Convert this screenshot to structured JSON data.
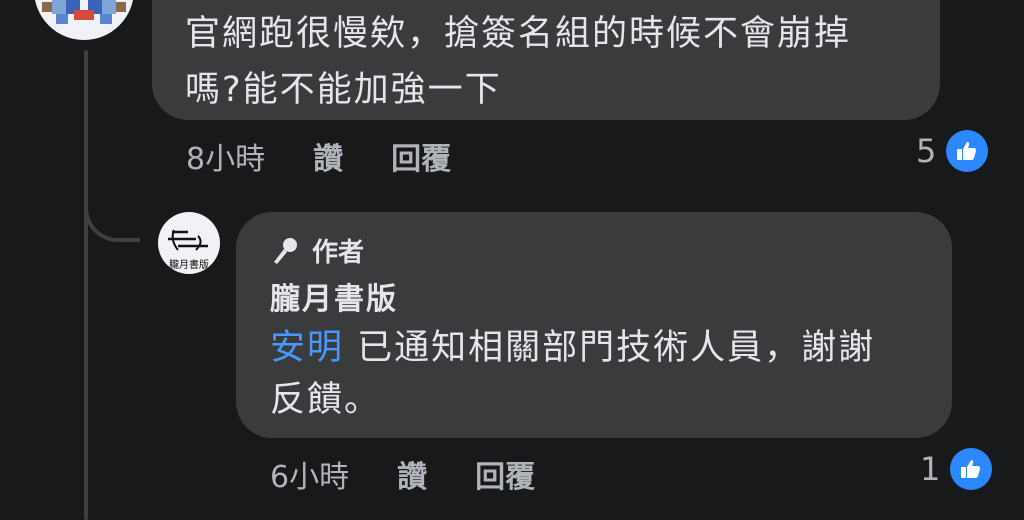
{
  "comment1": {
    "text_line1": "官網跑很慢欸，搶簽名組的時候不會崩掉",
    "text_line2": "嗎?能不能加強一下",
    "time": "8小時",
    "like_label": "讚",
    "reply_label": "回覆",
    "like_count": "5"
  },
  "reply1": {
    "badge_label": "作者",
    "author_name": "朧月書版",
    "avatar_text": "朧月書版",
    "mention": "安明",
    "text_line1": " 已通知相關部門技術人員，謝謝",
    "text_line2": "反饋。",
    "time": "6小時",
    "like_label": "讚",
    "reply_label": "回覆",
    "like_count": "1"
  },
  "colors": {
    "background": "#18191a",
    "bubble": "#3a3b3c",
    "mention": "#4599ff",
    "like_blue": "#2d88ff"
  }
}
